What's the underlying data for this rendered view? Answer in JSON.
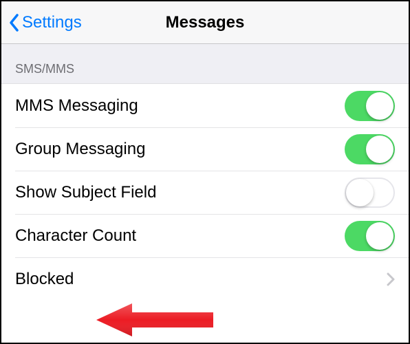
{
  "nav": {
    "back_label": "Settings",
    "title": "Messages"
  },
  "section": {
    "header": "SMS/MMS"
  },
  "rows": {
    "mms": {
      "label": "MMS Messaging",
      "on": true
    },
    "group": {
      "label": "Group Messaging",
      "on": true
    },
    "subject": {
      "label": "Show Subject Field",
      "on": false
    },
    "charcount": {
      "label": "Character Count",
      "on": true
    },
    "blocked": {
      "label": "Blocked"
    }
  },
  "annotation": {
    "arrow_color": "#ec1c24"
  }
}
